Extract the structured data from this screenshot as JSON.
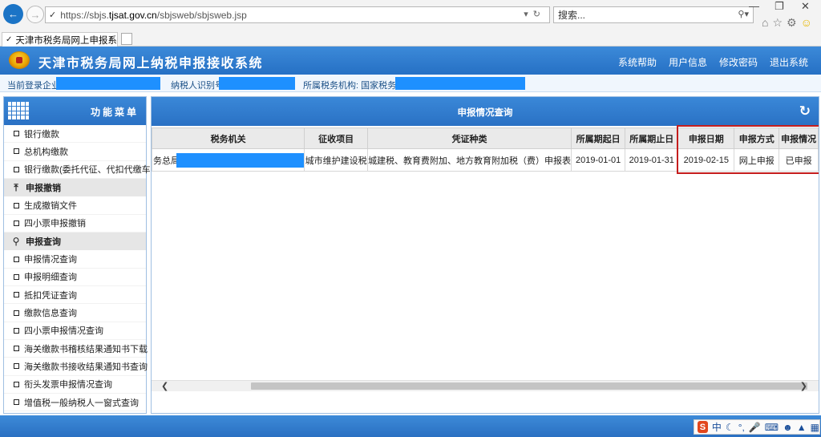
{
  "browser": {
    "url_prefix": "https://sbjs.",
    "url_host": "tjsat.gov.cn",
    "url_path": "/sbjsweb/sbjsweb.jsp",
    "search_placeholder": "搜索...",
    "tab_title": "天津市税务局网上申报系统...",
    "tab_close": "×"
  },
  "header": {
    "title": "天津市税务局网上纳税申报接收系统",
    "menu": [
      "系统帮助",
      "用户信息",
      "修改密码",
      "退出系统"
    ]
  },
  "info_bar": {
    "company_label": "当前登录企业:",
    "taxpayer_id_label": "纳税人识别号:",
    "tax_office_label": "所属税务机构: 国家税务总局"
  },
  "sidebar": {
    "title": "功能菜单",
    "items_top": [
      "银行缴款",
      "总机构缴款",
      "银行缴款(委托代征、代扣代缴车船税)"
    ],
    "group1": "申报撤销",
    "group1_items": [
      "生成撤销文件",
      "四小票申报撤销"
    ],
    "group2": "申报查询",
    "group2_items": [
      "申报情况查询",
      "申报明细查询",
      "抵扣凭证查询",
      "缴款信息查询",
      "四小票申报情况查询",
      "海关缴款书稽核结果通知书下载",
      "海关缴款书接收结果通知书查询",
      "衔头发票申报情况查询",
      "增值税一般纳税人一窗式查询"
    ]
  },
  "main": {
    "title": "申报情况查询",
    "columns": [
      "税务机关",
      "征收项目",
      "凭证种类",
      "所属期起日",
      "所属期止日",
      "申报日期",
      "申报方式",
      "申报情况"
    ],
    "rows": [
      [
        "务总局",
        "城市维护建设税",
        "城建税、教育费附加、地方教育附加税（费）申报表",
        "2019-01-01",
        "2019-01-31",
        "2019-02-15",
        "网上申报",
        "已申报"
      ]
    ]
  },
  "ime": {
    "logo": "S",
    "mode": "中"
  },
  "colors": {
    "header_blue": "#2a71c4",
    "mask_blue": "#1e90ff",
    "highlight_red": "#c51d1d"
  }
}
